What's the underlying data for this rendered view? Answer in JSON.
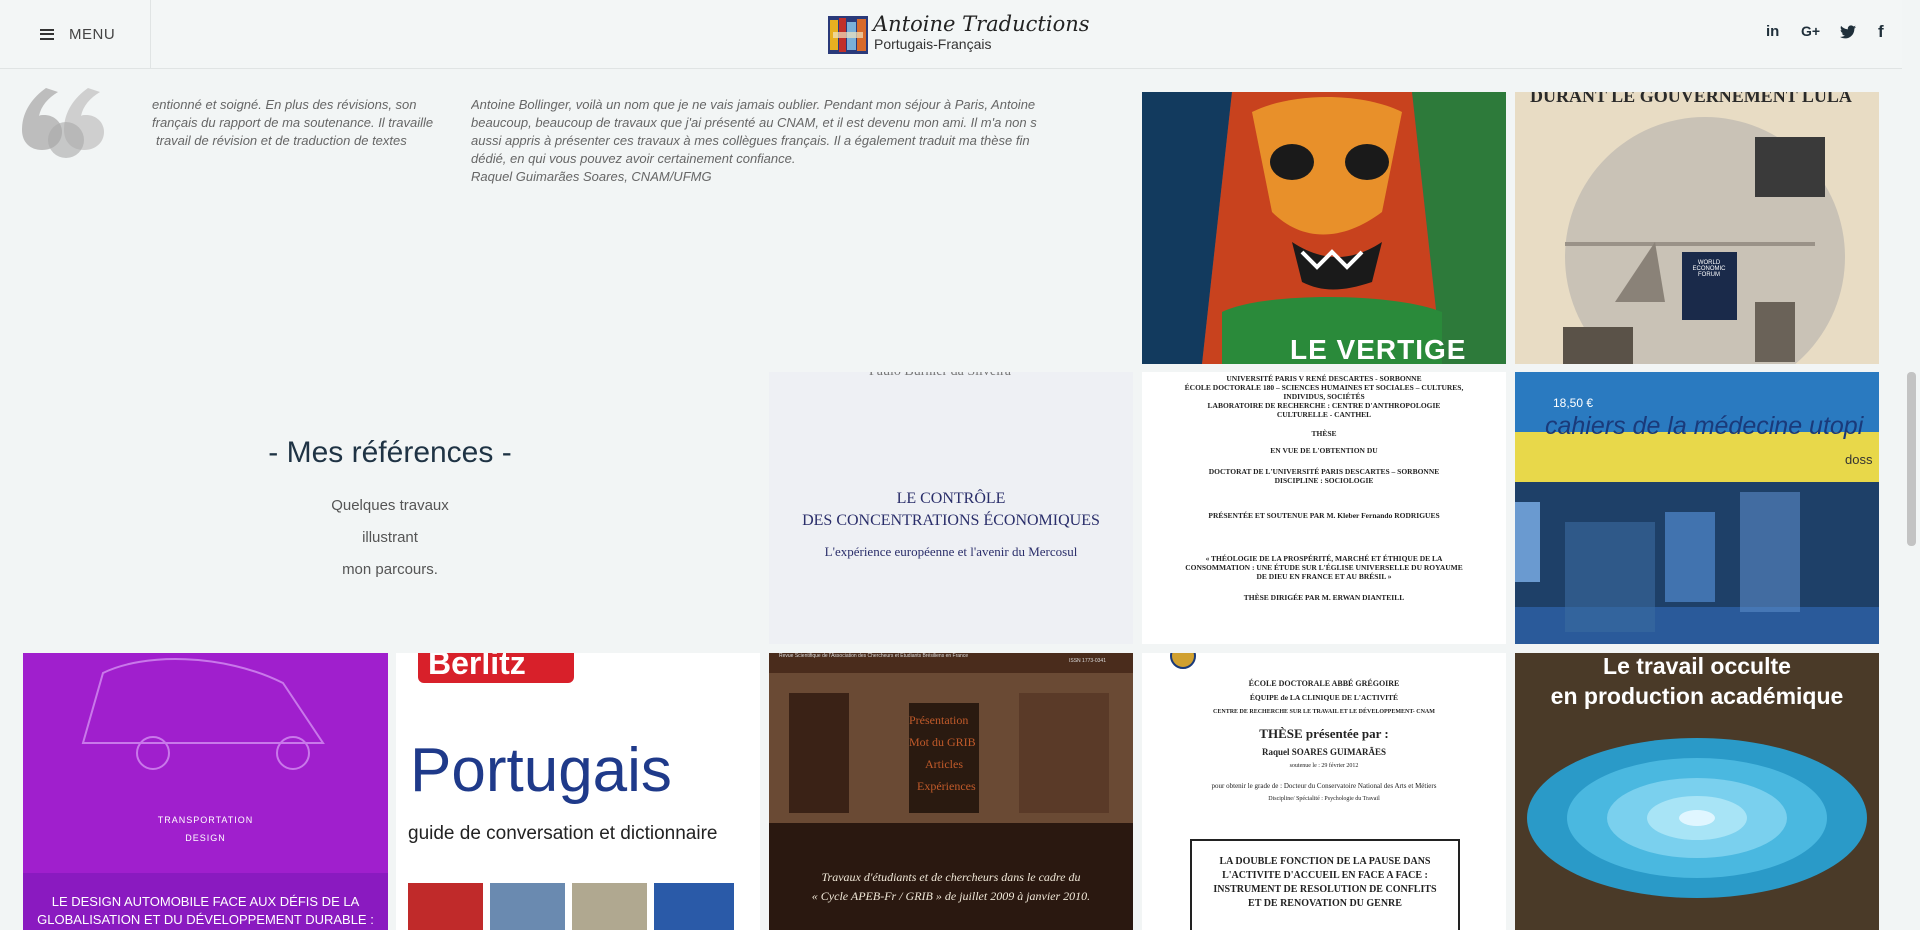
{
  "header": {
    "menu_label": "MENU",
    "brand": "Antoine Traductions",
    "tagline": "Portugais-Français",
    "social": [
      "in",
      "G+",
      "twitter-icon",
      "f"
    ]
  },
  "testimonials": [
    {
      "lines": [
        "entionné et soigné. En plus des révisions, son",
        "français du rapport de ma soutenance. Il travaille",
        "travail de révision et de traduction de textes"
      ]
    },
    {
      "lines": [
        "Antoine Bollinger, voilà un nom que je ne vais jamais oublier. Pendant mon séjour à Paris, Antoine",
        "beaucoup, beaucoup de travaux que j'ai présenté au CNAM, et il est devenu mon ami. Il m'a non s",
        "aussi appris à présenter ces travaux à mes collègues français. Il a également traduit ma thèse fin",
        "dédié, en qui vous pouvez avoir certainement confiance.",
        "Raquel Guimarães Soares, CNAM/UFMG"
      ]
    }
  ],
  "references": {
    "title": "- Mes références -",
    "description": [
      "Quelques travaux",
      "illustrant",
      "mon parcours."
    ]
  },
  "tiles": {
    "vertige": "LE VERTIGE",
    "lula_title": "DURANT LE GOUVERNEMENT LULA",
    "lula_badge": "WORLD ECONOMIC FORUM",
    "controle_author": "Paulo Burnier da Silveira",
    "controle_title": [
      "LE CONTRÔLE",
      "DES CONCENTRATIONS ÉCONOMIQUES"
    ],
    "controle_sub": "L'expérience européenne et l'avenir du Mercosul",
    "these1_lines": [
      "UNIVERSITÉ PARIS V RENÉ DESCARTES - SORBONNE",
      "ÉCOLE DOCTORALE 180 – SCIENCES HUMAINES ET SOCIALES – CULTURES,",
      "INDIVIDUS, SOCIÉTÉS",
      "LABORATOIRE DE RECHERCHE : CENTRE D'ANTHROPOLOGIE",
      "CULTURELLE - CANTHEL",
      "THÈSE",
      "EN VUE DE L'OBTENTION DU",
      "DOCTORAT DE L'UNIVERSITÉ PARIS DESCARTES – SORBONNE",
      "DISCIPLINE : SOCIOLOGIE",
      "PRÉSENTÉE ET SOUTENUE PAR M. Kleber Fernando RODRIGUES",
      "« THÉOLOGIE DE LA PROSPÉRITÉ, MARCHÉ ET ÉTHIQUE DE LA",
      "CONSOMMATION : UNE ÉTUDE SUR L'ÉGLISE UNIVERSELLE DU ROYAUME",
      "DE DIEU EN FRANCE ET AU BRÉSIL »",
      "THÈSE DIRIGÉE PAR M. ERWAN DIANTEILL"
    ],
    "cahiers_price": "18,50 €",
    "cahiers_title": "cahiers de la médecine utopi",
    "cahiers_tag": "doss",
    "design_lines": [
      "TRANSPORTATION",
      "DESIGN"
    ],
    "design_caption": [
      "LE DESIGN AUTOMOBILE FACE AUX DÉFIS DE LA",
      "GLOBALISATION ET DU DÉVELOPPEMENT DURABLE :"
    ],
    "berlitz_brand": "Berlitz",
    "berlitz_title": "Portugais",
    "berlitz_sub": "guide de conversation et dictionnaire",
    "apeb_header": "Revue Scientifique de l'Association des Chercheurs et Étudiants Brésiliens en France",
    "apeb_issn": "ISSN 1773-0341",
    "apeb_menu": [
      "Présentation",
      "Mot du GRIB",
      "Articles",
      "Expériences"
    ],
    "apeb_caption": [
      "Travaux d'étudiants et de chercheurs dans le cadre du",
      "« Cycle APEB-Fr / GRIB » de juillet 2009 à janvier 2010."
    ],
    "these2_lines": [
      "ÉCOLE DOCTORALE ABBÉ GRÉGOIRE",
      "ÉQUIPE de LA CLINIQUE DE L'ACTIVITÉ",
      "CENTRE DE RECHERCHE SUR LE TRAVAIL ET LE DÉVELOPPEMENT- CNAM",
      "THÈSE présentée par :",
      "Raquel SOARES GUIMARÃES",
      "soutenue le : 29 février 2012",
      "pour obtenir le grade de : Docteur du Conservatoire National des Arts et Métiers",
      "Discipline/ Spécialité : Psychologie du Travail"
    ],
    "these2_box": [
      "LA DOUBLE FONCTION DE LA PAUSE DANS",
      "L'ACTIVITE D'ACCUEIL EN FACE A FACE :",
      "INSTRUMENT DE RESOLUTION DE CONFLITS",
      "ET DE RENOVATION DU GENRE"
    ],
    "travail_title": [
      "Le travail occulte",
      "en production académique"
    ]
  }
}
